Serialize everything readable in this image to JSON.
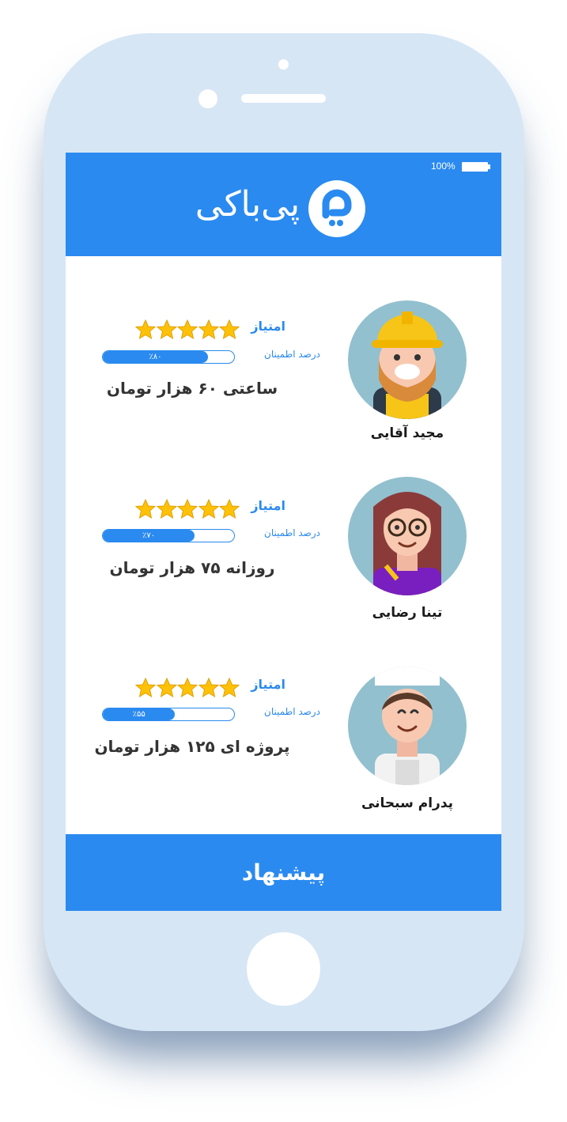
{
  "status_bar": {
    "battery": "100%"
  },
  "header": {
    "brand": "پی‌باکی",
    "logo_icon": "pibaki-logo-icon"
  },
  "colors": {
    "primary": "#2a8af0",
    "star": "#ffc107",
    "avatar_bg": "#92c0cf"
  },
  "workers": [
    {
      "name": "مجید آقایی",
      "avatar": "construction-worker-avatar",
      "score_label": "امتیاز",
      "stars": 5,
      "trust_label": "درصد اطمینان",
      "trust_text": "٪۸۰",
      "trust_value": 0.8,
      "price": "ساعتی ۶۰ هزار تومان"
    },
    {
      "name": "تینا رضایی",
      "avatar": "artist-woman-avatar",
      "score_label": "امتیاز",
      "stars": 5,
      "trust_label": "درصد اطمینان",
      "trust_text": "٪۷۰",
      "trust_value": 0.7,
      "price": "روزانه ۷۵ هزار تومان"
    },
    {
      "name": "پدرام سبحانی",
      "avatar": "chef-avatar",
      "score_label": "امتیاز",
      "stars": 5,
      "trust_label": "درصد اطمینان",
      "trust_text": "٪۵۵",
      "trust_value": 0.55,
      "price": "پروژه ای ۱۲۵ هزار تومان"
    }
  ],
  "footer": {
    "button_label": "پیشنهاد"
  }
}
